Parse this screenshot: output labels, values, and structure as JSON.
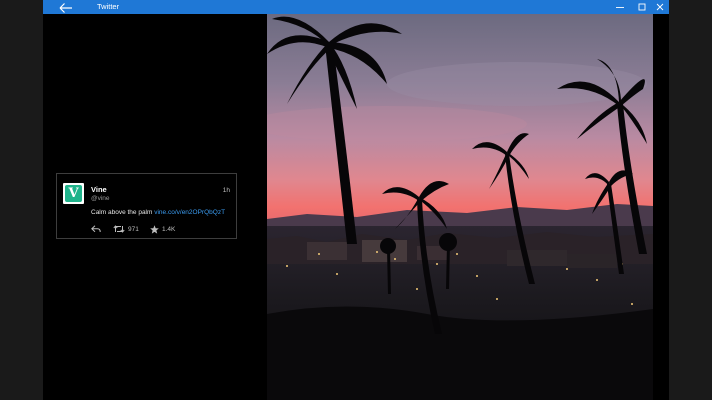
{
  "window": {
    "title": "Twitter",
    "accent_color": "#1f78d6",
    "controls": [
      "minimize-icon",
      "maximize-icon",
      "close-icon"
    ]
  },
  "tweet": {
    "avatar_letter": "V",
    "name": "Vine",
    "handle": "@vine",
    "time": "1h",
    "text": "Calm above the palm",
    "link": "vine.co/v/en2OPrQbQzT",
    "retweets": "971",
    "likes": "1.4K",
    "icons": [
      "reply-icon",
      "retweet-icon",
      "star-icon"
    ]
  },
  "media": {
    "description_icon": "photo"
  }
}
